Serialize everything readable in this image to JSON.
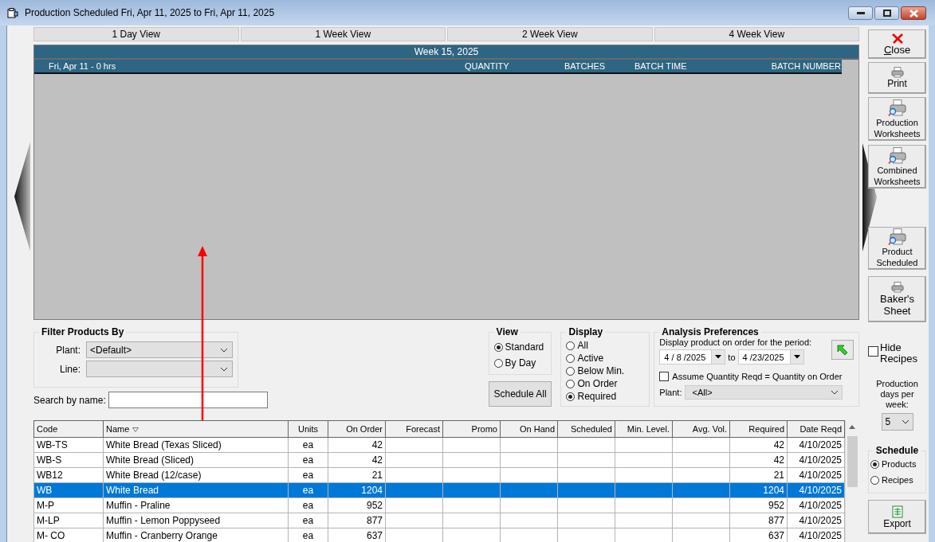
{
  "window": {
    "title": "Production Scheduled Fri, Apr 11, 2025 to Fri, Apr 11, 2025"
  },
  "view_tabs": [
    {
      "label": "1 Day View"
    },
    {
      "label": "1 Week View"
    },
    {
      "label": "2 Week View"
    },
    {
      "label": "4 Week View"
    }
  ],
  "schedule": {
    "week": "Week 15, 2025",
    "day_label": "Fri, Apr 11 - 0 hrs",
    "columns": [
      "QUANTITY",
      "BATCHES",
      "BATCH TIME",
      "BATCH NUMBER"
    ]
  },
  "filter": {
    "title": "Filter Products By",
    "plant_label": "Plant:",
    "plant_value": "<Default>",
    "line_label": "Line:"
  },
  "search": {
    "label": "Search by name:"
  },
  "view": {
    "title": "View",
    "options": [
      {
        "label": "Standard",
        "selected": true
      },
      {
        "label": "By Day",
        "selected": false
      }
    ]
  },
  "schedule_all": "Schedule All",
  "display": {
    "title": "Display",
    "options": [
      {
        "label": "All",
        "selected": false
      },
      {
        "label": "Active",
        "selected": false
      },
      {
        "label": "Below Min.",
        "selected": false
      },
      {
        "label": "On Order",
        "selected": false
      },
      {
        "label": "Required",
        "selected": true
      }
    ]
  },
  "analysis": {
    "title": "Analysis Preferences",
    "period_label": "Display product on order for the period:",
    "from": "4 / 8 /2025",
    "to_label": "to",
    "to": "4 /23/2025",
    "assume": {
      "label": "Assume Quantity Reqd = Quantity on Order",
      "checked": false
    },
    "plant_label": "Plant:",
    "plant_value": "<All>"
  },
  "table": {
    "columns": [
      "Code",
      "Name",
      "Units",
      "On Order",
      "Forecast",
      "Promo",
      "On Hand",
      "Scheduled",
      "Min. Level.",
      "Avg. Vol.",
      "Required",
      "Date Reqd"
    ],
    "rows": [
      {
        "selected": false,
        "cells": [
          "WB-TS",
          "White Bread (Texas Sliced)",
          "ea",
          "42",
          "",
          "",
          "",
          "",
          "",
          "",
          "42",
          "4/10/2025"
        ]
      },
      {
        "selected": false,
        "cells": [
          "WB-S",
          "White Bread (Sliced)",
          "ea",
          "42",
          "",
          "",
          "",
          "",
          "",
          "",
          "42",
          "4/10/2025"
        ]
      },
      {
        "selected": false,
        "cells": [
          "WB12",
          "White Bread (12/case)",
          "ea",
          "21",
          "",
          "",
          "",
          "",
          "",
          "",
          "21",
          "4/10/2025"
        ]
      },
      {
        "selected": true,
        "cells": [
          "WB",
          "White Bread",
          "ea",
          "1204",
          "",
          "",
          "",
          "",
          "",
          "",
          "1204",
          "4/10/2025"
        ]
      },
      {
        "selected": false,
        "cells": [
          "M-P",
          "Muffin - Praline",
          "ea",
          "952",
          "",
          "",
          "",
          "",
          "",
          "",
          "952",
          "4/10/2025"
        ]
      },
      {
        "selected": false,
        "cells": [
          "M-LP",
          "Muffin - Lemon Poppyseed",
          "ea",
          "877",
          "",
          "",
          "",
          "",
          "",
          "",
          "877",
          "4/10/2025"
        ]
      },
      {
        "selected": false,
        "cells": [
          "M- CO",
          "Muffin - Cranberry Orange",
          "ea",
          "637",
          "",
          "",
          "",
          "",
          "",
          "",
          "637",
          "4/10/2025"
        ]
      }
    ]
  },
  "actions": [
    {
      "kind": "close",
      "lines": [
        "Close"
      ],
      "underline_first": true
    },
    {
      "kind": "print",
      "lines": [
        "Print"
      ],
      "underline_first": false
    },
    {
      "kind": "worksheet",
      "lines": [
        "Production",
        "Worksheets"
      ],
      "underline_first": false
    },
    {
      "kind": "worksheet",
      "lines": [
        "Combined",
        "Worksheets"
      ],
      "underline_first": false
    },
    {
      "kind": "worksheet",
      "lines": [
        "Product",
        "Scheduled"
      ],
      "underline_first": false
    },
    {
      "kind": "print",
      "lines": [
        "Baker's",
        "Sheet"
      ],
      "underline_first": false
    }
  ],
  "hide_recipes": {
    "label": "Hide Recipes",
    "checked": false
  },
  "days_per_week": {
    "label": "Production days per week:",
    "value": "5"
  },
  "schedule_mode": {
    "title": "Schedule",
    "options": [
      {
        "label": "Products",
        "selected": true
      },
      {
        "label": "Recipes",
        "selected": false
      }
    ]
  },
  "export": {
    "label": "Export"
  }
}
